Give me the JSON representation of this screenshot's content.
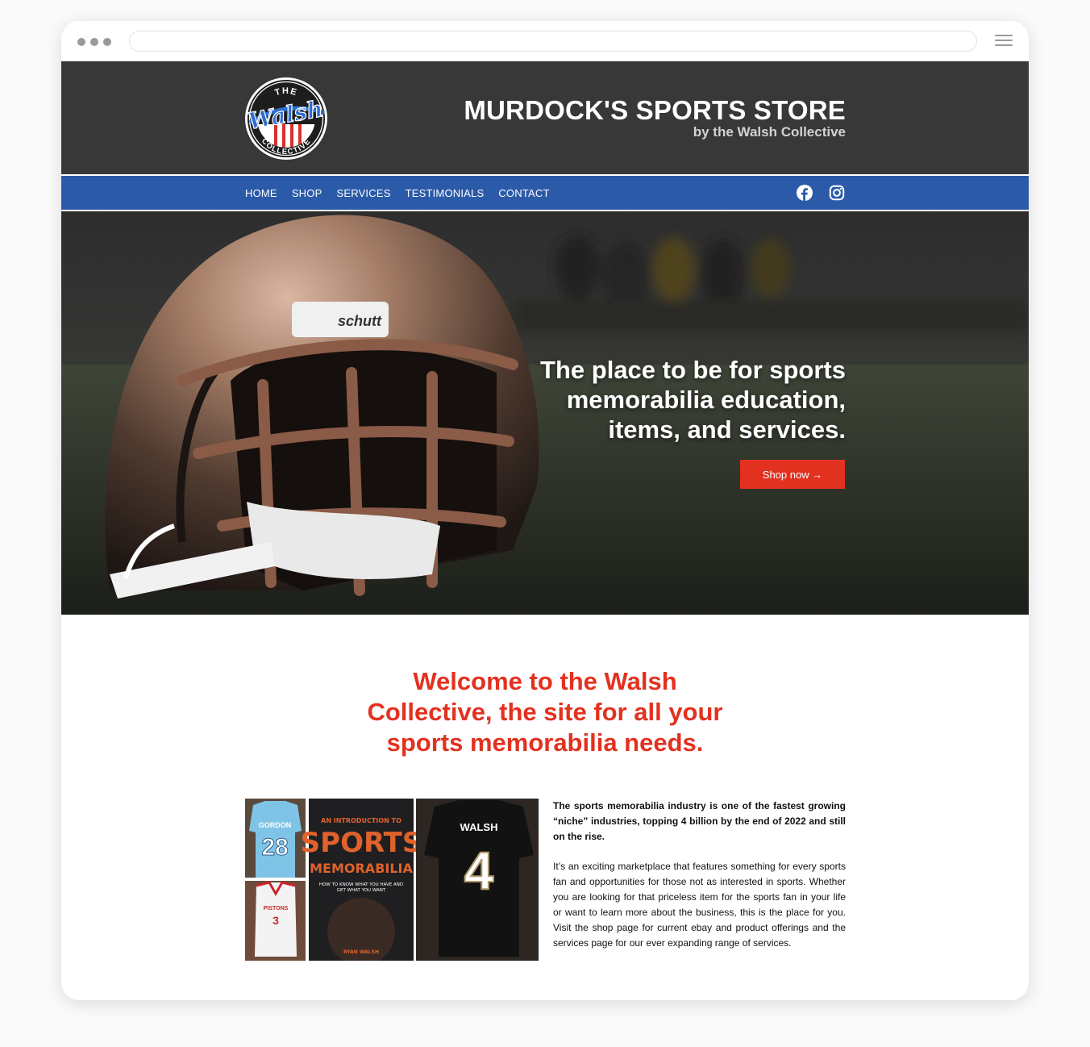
{
  "browser": {
    "url": ""
  },
  "header": {
    "logo_top": "THE",
    "logo_script": "Walsh",
    "logo_bottom": "COLLECTIVE",
    "title": "MURDOCK'S SPORTS STORE",
    "subtitle": "by the Walsh Collective"
  },
  "nav": {
    "items": [
      {
        "label": "HOME"
      },
      {
        "label": "SHOP"
      },
      {
        "label": "SERVICES"
      },
      {
        "label": "TESTIMONIALS"
      },
      {
        "label": "CONTACT"
      }
    ],
    "social_icons": [
      "facebook-icon",
      "instagram-icon"
    ]
  },
  "hero": {
    "headline": "The place to be for sports memorabilia education, items, and services.",
    "button_label": "Shop now →",
    "helmet_brand": "schutt"
  },
  "welcome": {
    "heading": "Welcome to the Walsh Collective, the site for all your sports memorabilia needs."
  },
  "collage": {
    "jersey1_name": "GORDON",
    "jersey1_number": "28",
    "jersey2_name": "PISTONS",
    "jersey2_number": "3",
    "book_line1": "AN INTRODUCTION TO",
    "book_line2": "SPORTS",
    "book_line3": "MEMORABILIA",
    "book_tagline": "HOW TO KNOW WHAT YOU HAVE AND GET WHAT YOU WANT",
    "book_author": "RYAN WALSH",
    "jersey3_name": "WALSH",
    "jersey3_number": "4"
  },
  "body": {
    "lead": "The sports memorabilia industry is one of the fastest growing “niche” industries, topping 4 billion by the end of 2022 and still on the rise.",
    "paragraph": "It’s an exciting marketplace that features something for every sports fan and opportunities for those not as interested in sports. Whether you are looking for that priceless item for the sports fan in your life or want to learn more about the business, this is the place for you. Visit the shop page for current ebay and product offerings and the services page for our ever expanding range of services."
  },
  "colors": {
    "header_bg": "#383838",
    "nav_bg": "#2b5aa8",
    "accent_red": "#e3311f",
    "logo_blue": "#2f6ed3"
  }
}
